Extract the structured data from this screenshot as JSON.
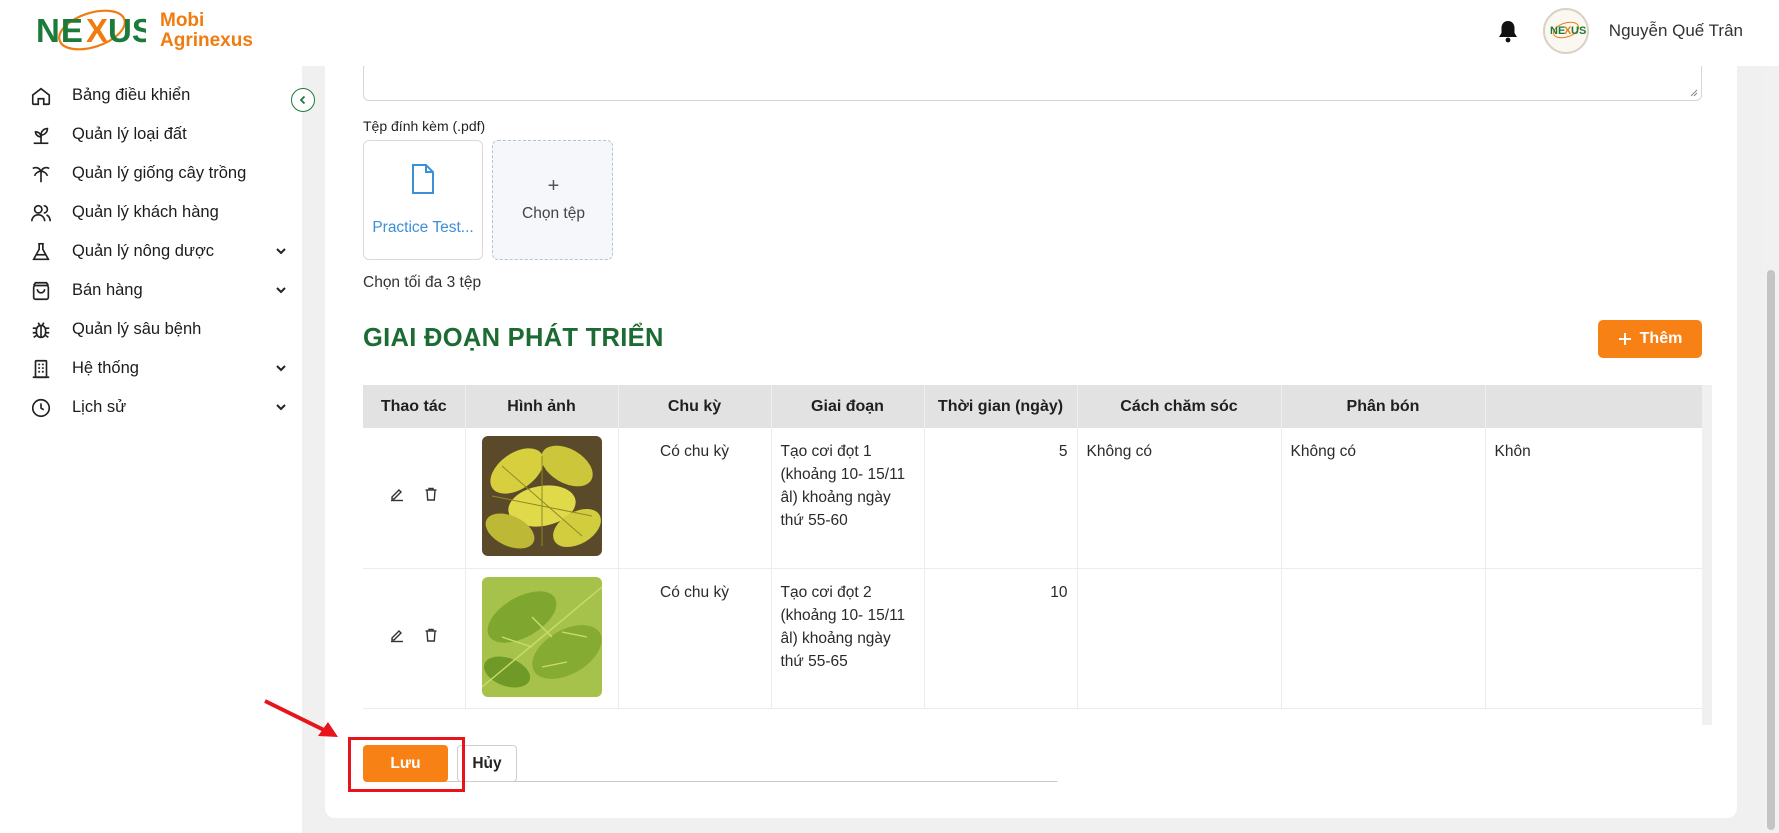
{
  "header": {
    "brand_line1": "Mobi",
    "brand_line2": "Agrinexus",
    "logo_word": "NEXUS",
    "user_name": "Nguyễn Quế Trân",
    "avatar_word": "NEXUS"
  },
  "sidebar": {
    "items": [
      {
        "label": "Bảng điều khiển",
        "icon": "home-icon",
        "has_children": false
      },
      {
        "label": "Quản lý loại đất",
        "icon": "seedling-icon",
        "has_children": false
      },
      {
        "label": "Quản lý giống cây trồng",
        "icon": "palm-tree-icon",
        "has_children": false
      },
      {
        "label": "Quản lý khách hàng",
        "icon": "users-icon",
        "has_children": false
      },
      {
        "label": "Quản lý nông dược",
        "icon": "flask-icon",
        "has_children": true
      },
      {
        "label": "Bán hàng",
        "icon": "shopping-bag-icon",
        "has_children": true
      },
      {
        "label": "Quản lý sâu bệnh",
        "icon": "bug-icon",
        "has_children": false
      },
      {
        "label": "Hệ thống",
        "icon": "building-icon",
        "has_children": true
      },
      {
        "label": "Lịch sử",
        "icon": "clock-icon",
        "has_children": true
      }
    ]
  },
  "attachments": {
    "label": "Tệp đính kèm (.pdf)",
    "files": [
      {
        "name": "Practice Test..."
      }
    ],
    "upload_plus": "+",
    "upload_label": "Chọn tệp",
    "hint": "Chọn tối đa 3 tệp"
  },
  "growth_stages": {
    "title": "GIAI ĐOẠN PHÁT TRIỂN",
    "add_label": "Thêm",
    "columns": [
      "Thao tác",
      "Hình ảnh",
      "Chu kỳ",
      "Giai đoạn",
      "Thời gian (ngày)",
      "Cách chăm sóc",
      "Phân bón",
      ""
    ],
    "rows": [
      {
        "cycle": "Có chu kỳ",
        "stage": "Tạo cơi đọt 1 (khoảng 10- 15/11 âl) khoảng ngày thứ 55-60",
        "days": "5",
        "care": "Không có",
        "fertilizer": "Không có",
        "extra": "Khôn",
        "leaf_color": "#c9c33a"
      },
      {
        "cycle": "Có chu kỳ",
        "stage": "Tạo cơi đọt 2 (khoảng 10- 15/11 âl) khoảng ngày thứ 55-65",
        "days": "10",
        "care": "",
        "fertilizer": "",
        "extra": "",
        "leaf_color": "#7fa62e"
      }
    ]
  },
  "footer": {
    "save_label": "Lưu",
    "cancel_label": "Hủy"
  },
  "colors": {
    "accent": "#f78115",
    "title_green": "#1b6b33",
    "annotation_red": "#e8141b"
  }
}
